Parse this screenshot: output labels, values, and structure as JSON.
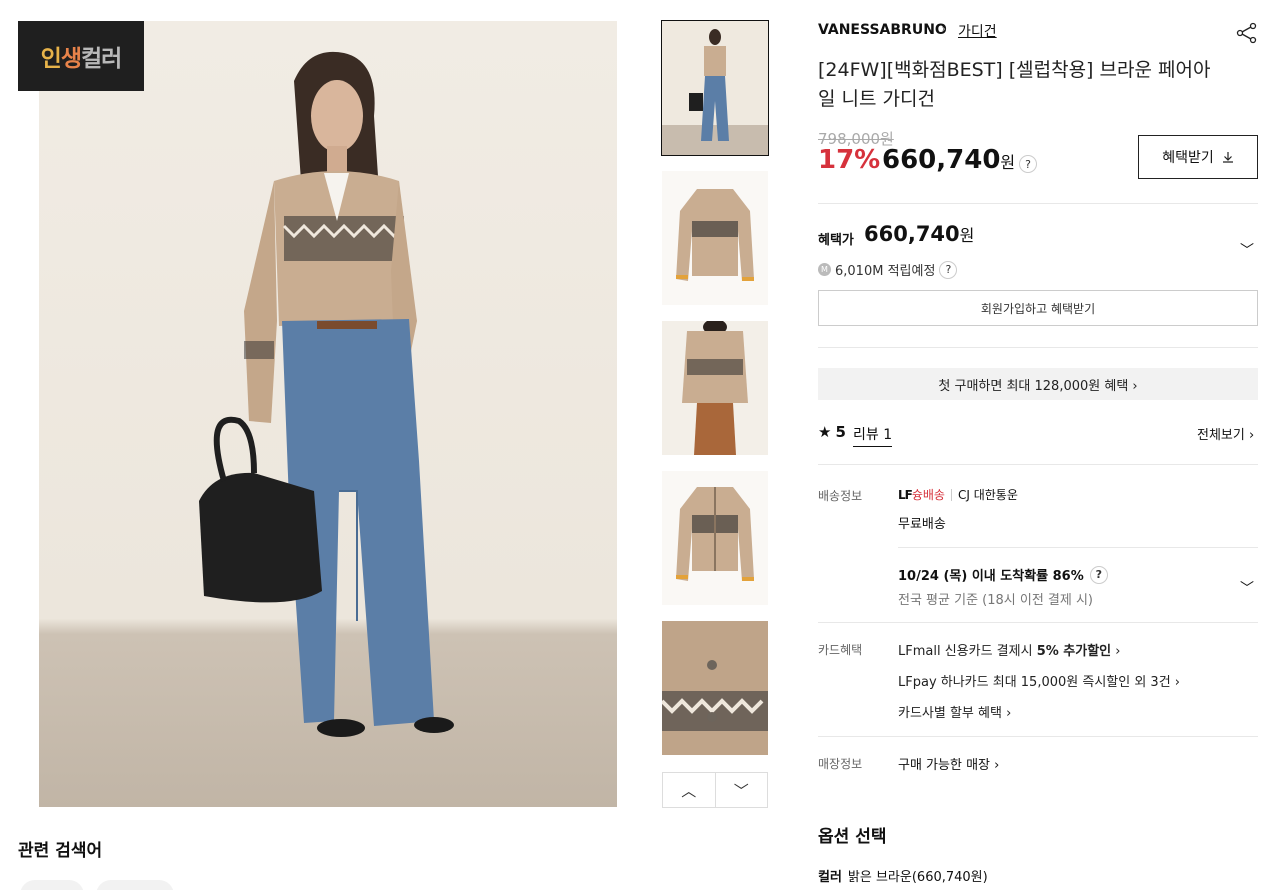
{
  "badge": {
    "part1": "인",
    "part2": "생",
    "part3": "컬러"
  },
  "gallery": {
    "up_icon": "chevron-up-icon",
    "down_icon": "chevron-down-icon"
  },
  "related": {
    "title": "관련 검색어"
  },
  "product": {
    "brand": "VANESSABRUNO",
    "category": "가디건",
    "title": "[24FW][백화점BEST] [셀럽착용] 브라운 페어아일 니트 가디건",
    "original_price": "798,000원",
    "discount": "17%",
    "price": "660,740",
    "currency": "원",
    "benefit_button": "혜택받기"
  },
  "benefit": {
    "label": "혜택가",
    "price": "660,740",
    "currency": "원",
    "points": "6,010M 적립예정",
    "join_button": "회원가입하고 혜택받기",
    "first_purchase": "첫 구매하면 최대 128,000원 혜택 ›"
  },
  "review": {
    "score": "5",
    "label": "리뷰 1",
    "view_all": "전체보기 ›"
  },
  "shipping": {
    "label": "배송정보",
    "logo_prefix": "LF",
    "logo_suffix": "슝배송",
    "carrier": "CJ 대한통운",
    "fee": "무료배송",
    "arrival": "10/24 (목) 이내 도착확률 86%",
    "arrival_sub": "전국 평균 기준 (18시 이전 결제 시)"
  },
  "card": {
    "label": "카드혜택",
    "line1_pre": "LFmall 신용카드 결제시 ",
    "line1_bold": "5% 추가할인",
    "line2": "LFpay 하나카드 최대 15,000원 즉시할인 외 3건 ›",
    "line3": "카드사별 할부 혜택 ›"
  },
  "store": {
    "label": "매장정보",
    "link": "구매 가능한 매장 ›"
  },
  "options": {
    "title": "옵션 선택",
    "color_label": "컬러",
    "color_value": "밝은 브라운(660,740원)"
  },
  "colors": {
    "sale_red": "#d6323c",
    "text": "#111111",
    "border": "#e8e8e8"
  }
}
